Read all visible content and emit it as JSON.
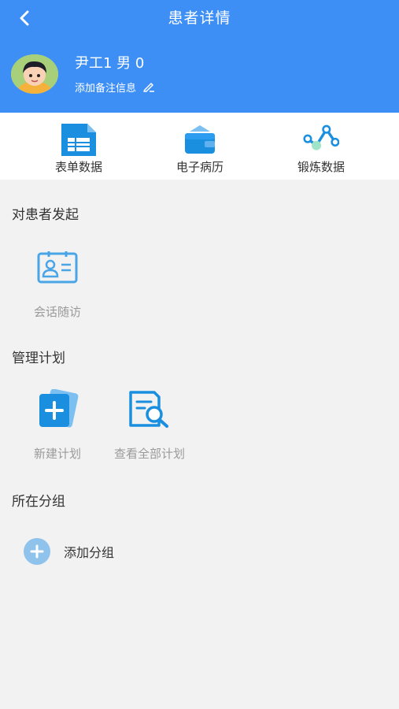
{
  "header": {
    "title": "患者详情",
    "back_icon": "chevron-left-icon"
  },
  "patient": {
    "name_line": "尹工1 男 0",
    "remark_label": "添加备注信息",
    "remark_icon": "pencil-icon"
  },
  "quick_actions": [
    {
      "label": "表单数据",
      "icon": "form-sheet-icon"
    },
    {
      "label": "电子病历",
      "icon": "medical-record-box-icon"
    },
    {
      "label": "锻炼数据",
      "icon": "exercise-chart-icon"
    }
  ],
  "sections": {
    "initiate": {
      "title": "对患者发起",
      "items": [
        {
          "label": "会话随访",
          "icon": "id-card-icon"
        }
      ]
    },
    "plans": {
      "title": "管理计划",
      "items": [
        {
          "label": "新建计划",
          "icon": "new-plan-icon"
        },
        {
          "label": "查看全部计划",
          "icon": "search-document-icon"
        }
      ]
    },
    "groups": {
      "title": "所在分组",
      "add_label": "添加分组",
      "add_icon": "plus-circle-icon"
    }
  },
  "colors": {
    "header_bg": "#3d8ff5",
    "accent_blue": "#1a8fe0",
    "page_bg": "#f2f2f2"
  }
}
